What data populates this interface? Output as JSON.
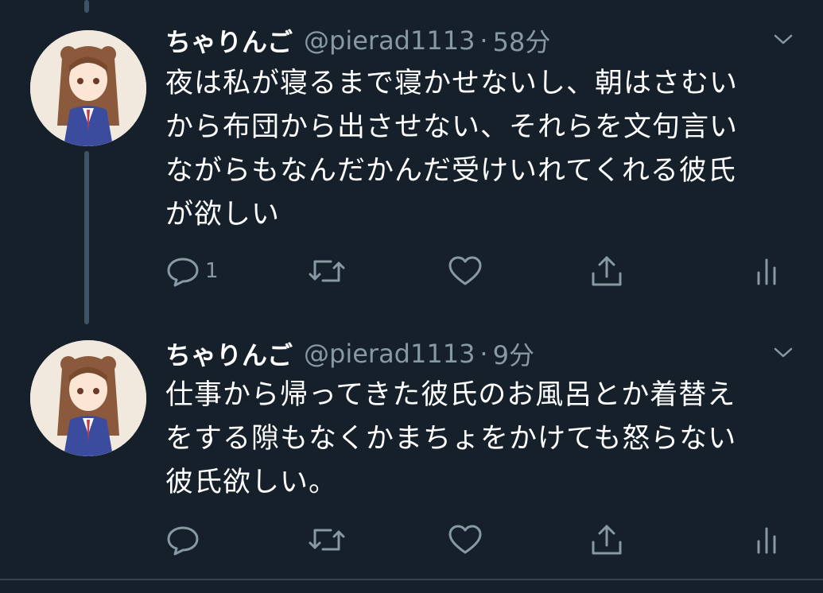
{
  "colors": {
    "background": "#15202b",
    "text_primary": "#ffffff",
    "text_secondary": "#8899a6",
    "thread_line": "#3d5466",
    "divider": "#38444d"
  },
  "tweets": [
    {
      "display_name": "ちゃりんご",
      "handle": "@pierad1113",
      "separator": "·",
      "time": "58分",
      "text_lines": [
        "夜は私が寝るまで寝かせないし、朝はさむい",
        "から布団から出させない、それらを文句言い",
        "ながらもなんだかんだ受けいれてくれる彼氏",
        "が欲しい"
      ],
      "reply_count": "1",
      "icons": [
        "reply-icon",
        "retweet-icon",
        "like-icon",
        "share-icon",
        "analytics-icon"
      ]
    },
    {
      "display_name": "ちゃりんご",
      "handle": "@pierad1113",
      "separator": "·",
      "time": "9分",
      "text_lines": [
        "仕事から帰ってきた彼氏のお風呂とか着替え",
        "をする隙もなくかまちょをかけても怒らない",
        "彼氏欲しい。"
      ],
      "reply_count": "",
      "icons": [
        "reply-icon",
        "retweet-icon",
        "like-icon",
        "share-icon",
        "analytics-icon"
      ]
    }
  ]
}
